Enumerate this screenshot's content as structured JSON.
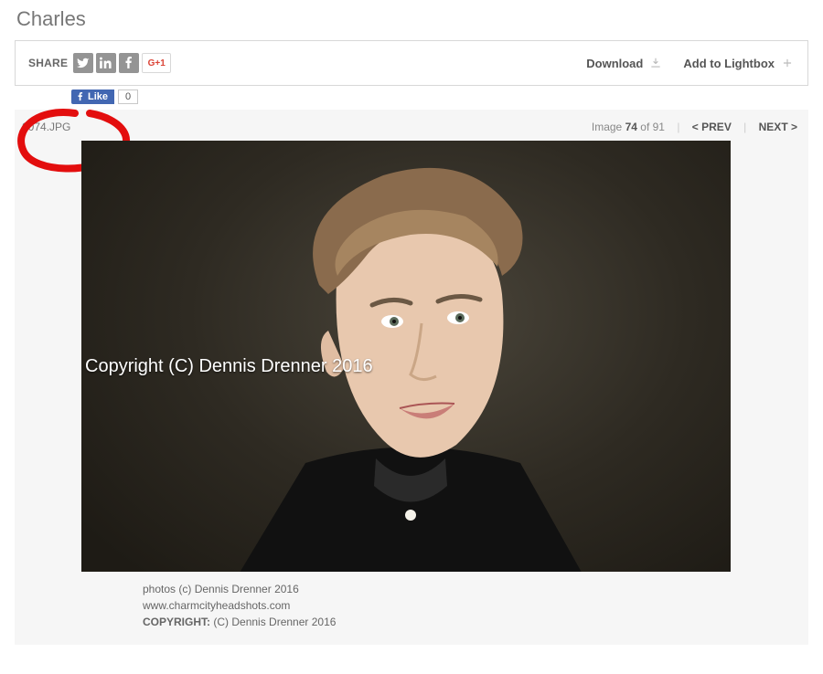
{
  "title": "Charles",
  "toolbar": {
    "share_label": "SHARE",
    "gplus_label": "G+1",
    "download_label": "Download",
    "lightbox_label": "Add to Lightbox"
  },
  "like": {
    "button_text": "Like",
    "count": "0"
  },
  "meta": {
    "filename": "0074.JPG",
    "image_word": "Image",
    "current": "74",
    "of_word": "of",
    "total": "91",
    "prev": "< PREV",
    "next": "NEXT >"
  },
  "photo": {
    "watermark": "Copyright (C) Dennis Drenner 2016"
  },
  "credits": {
    "line1": "photos (c) Dennis Drenner 2016",
    "line2": "www.charmcityheadshots.com",
    "copyright_label": "COPYRIGHT:",
    "copyright_value": "(C) Dennis Drenner 2016"
  }
}
